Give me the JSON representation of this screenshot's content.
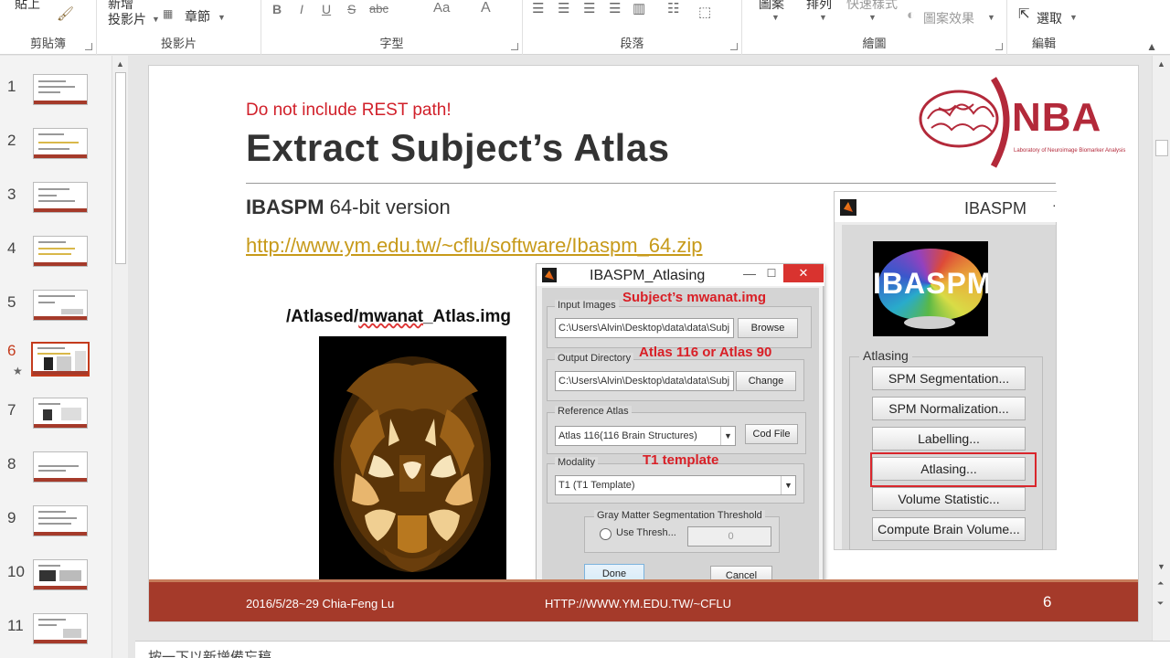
{
  "ribbon": {
    "paste_label": "貼上",
    "new_slide_label": "新增\n投影片",
    "section_label": "章節",
    "shapes_label": "圖案",
    "arrange_label": "排列",
    "quick_styles_label": "快速樣式",
    "shape_effects_label": "圖案效果",
    "select_label": "選取",
    "groups": {
      "clipboard": "剪貼簿",
      "slides": "投影片",
      "font": "字型",
      "paragraph": "段落",
      "drawing": "繪圖",
      "editing": "編輯"
    },
    "font_buttons": [
      "B",
      "I",
      "U",
      "S",
      "abc",
      "Aa",
      "A"
    ]
  },
  "thumbnails": {
    "numbers": [
      "1",
      "2",
      "3",
      "4",
      "5",
      "6",
      "7",
      "8",
      "9",
      "10",
      "11"
    ],
    "active_index": 6,
    "star": "★"
  },
  "slide": {
    "red_note": "Do not include REST path!",
    "title": "Extract Subject’s Atlas",
    "subtitle_bold": "IBASPM",
    "subtitle_rest": " 64-bit version",
    "link": "http://www.ym.edu.tw/~cflu/software/Ibaspm_64.zip",
    "caption_prefix": "/Atlased/",
    "caption_squiggle": "mwanat",
    "caption_suffix": "_Atlas.img",
    "logo_text": "NBA",
    "logo_small": "Laboratory of Neuroimage Biomarker Analysis",
    "footer_left": "2016/5/28~29 Chia-Feng Lu",
    "footer_mid": "HTTP://WWW.YM.EDU.TW/~CFLU",
    "footer_page": "6"
  },
  "ibaspm_window": {
    "title": "IBASPM",
    "logo_word": "IBASPM",
    "group_label": "Atlasing",
    "buttons": [
      "SPM Segmentation...",
      "SPM Normalization...",
      "Labelling...",
      "Atlasing...",
      "Volume Statistic...",
      "Compute Brain Volume..."
    ]
  },
  "atlas_dialog": {
    "title": "IBASPM_Atlasing",
    "close_glyph": "✕",
    "input_images": {
      "label": "Input Images",
      "value": "C:\\Users\\Alvin\\Desktop\\data\\data\\Subj",
      "button": "Browse",
      "annotation": "Subject’s mwanat.img"
    },
    "output_directory": {
      "label": "Output Directory",
      "value": "C:\\Users\\Alvin\\Desktop\\data\\data\\Subj",
      "button": "Change",
      "annotation": "Atlas 116 or Atlas 90"
    },
    "reference_atlas": {
      "label": "Reference Atlas",
      "value": "Atlas 116(116 Brain Structures)",
      "button": "Cod File"
    },
    "modality": {
      "label": "Modality",
      "value": "T1 (T1 Template)",
      "annotation": "T1 template"
    },
    "threshold": {
      "label": "Gray Matter Segmentation Threshold",
      "radio_label": "Use Thresh...",
      "value": "0"
    },
    "done_label": "Done",
    "cancel_label": "Cancel"
  },
  "notes_placeholder": "按一下以新增備忘稿"
}
